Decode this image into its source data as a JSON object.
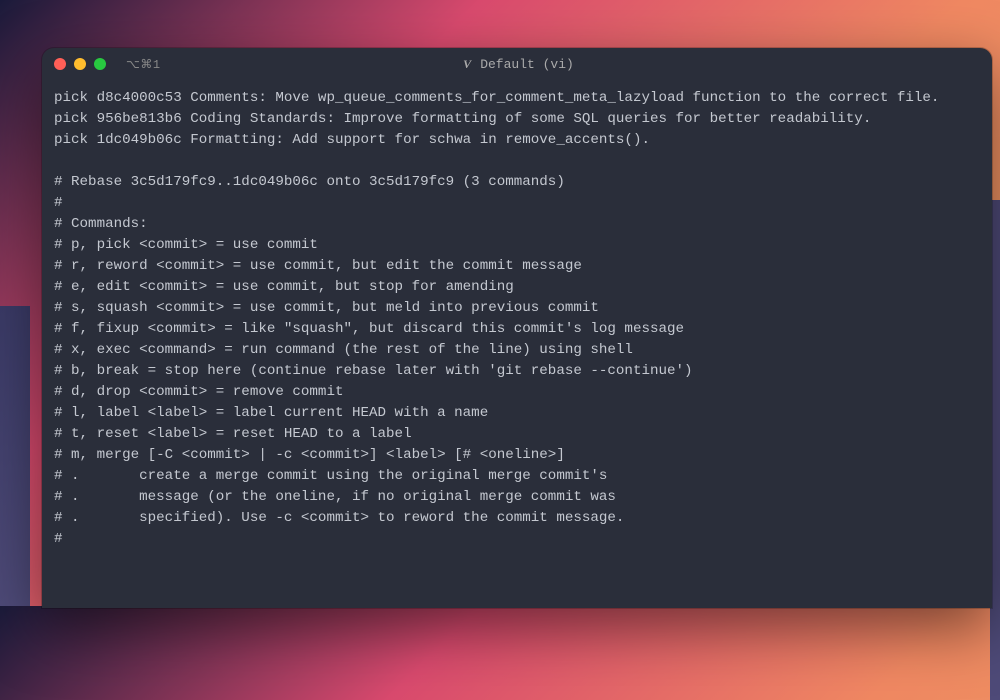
{
  "window": {
    "tab_indicator": "⌥⌘1",
    "title": "Default (vi)"
  },
  "editor": {
    "lines": [
      "pick d8c4000c53 Comments: Move wp_queue_comments_for_comment_meta_lazyload function to the correct file.",
      "pick 956be813b6 Coding Standards: Improve formatting of some SQL queries for better readability.",
      "pick 1dc049b06c Formatting: Add support for schwa in remove_accents().",
      "",
      "# Rebase 3c5d179fc9..1dc049b06c onto 3c5d179fc9 (3 commands)",
      "#",
      "# Commands:",
      "# p, pick <commit> = use commit",
      "# r, reword <commit> = use commit, but edit the commit message",
      "# e, edit <commit> = use commit, but stop for amending",
      "# s, squash <commit> = use commit, but meld into previous commit",
      "# f, fixup <commit> = like \"squash\", but discard this commit's log message",
      "# x, exec <command> = run command (the rest of the line) using shell",
      "# b, break = stop here (continue rebase later with 'git rebase --continue')",
      "# d, drop <commit> = remove commit",
      "# l, label <label> = label current HEAD with a name",
      "# t, reset <label> = reset HEAD to a label",
      "# m, merge [-C <commit> | -c <commit>] <label> [# <oneline>]",
      "# .       create a merge commit using the original merge commit's",
      "# .       message (or the oneline, if no original merge commit was",
      "# .       specified). Use -c <commit> to reword the commit message.",
      "#"
    ]
  }
}
